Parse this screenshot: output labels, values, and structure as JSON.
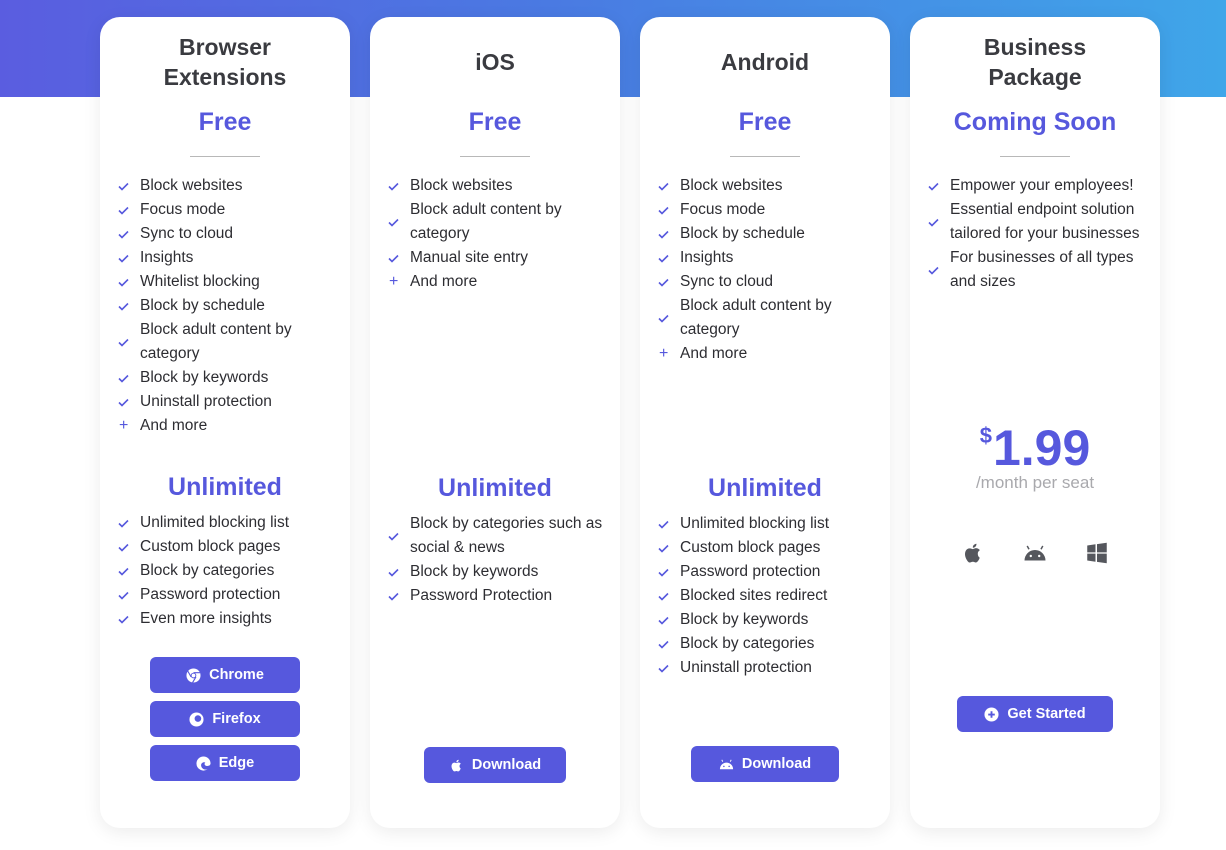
{
  "colors": {
    "accent": "#5658dd",
    "gradient_start": "#5a5de0",
    "gradient_end": "#3fa6e9",
    "title_text": "#3a3b40",
    "muted_text": "#a9a9ad"
  },
  "cards": [
    {
      "title": "Browser Extensions",
      "tier1": {
        "label": "Free",
        "features": [
          {
            "icon": "check-icon",
            "text": "Block websites"
          },
          {
            "icon": "check-icon",
            "text": "Focus mode"
          },
          {
            "icon": "check-icon",
            "text": "Sync to cloud"
          },
          {
            "icon": "check-icon",
            "text": "Insights"
          },
          {
            "icon": "check-icon",
            "text": "Whitelist blocking"
          },
          {
            "icon": "check-icon",
            "text": "Block by schedule"
          },
          {
            "icon": "check-icon",
            "text": "Block adult content by category"
          },
          {
            "icon": "check-icon",
            "text": "Block by keywords"
          },
          {
            "icon": "check-icon",
            "text": "Uninstall protection"
          },
          {
            "icon": "plus-icon",
            "text": "And more"
          }
        ]
      },
      "tier2": {
        "label": "Unlimited",
        "features": [
          {
            "icon": "check-icon",
            "text": "Unlimited blocking list"
          },
          {
            "icon": "check-icon",
            "text": "Custom block pages"
          },
          {
            "icon": "check-icon",
            "text": "Block by categories"
          },
          {
            "icon": "check-icon",
            "text": "Password protection"
          },
          {
            "icon": "check-icon",
            "text": "Even more insights"
          }
        ]
      },
      "buttons": [
        {
          "icon": "chrome-icon",
          "label": "Chrome"
        },
        {
          "icon": "firefox-icon",
          "label": "Firefox"
        },
        {
          "icon": "edge-icon",
          "label": "Edge"
        }
      ]
    },
    {
      "title": "iOS",
      "tier1": {
        "label": "Free",
        "features": [
          {
            "icon": "check-icon",
            "text": "Block websites"
          },
          {
            "icon": "check-icon",
            "text": "Block adult content by category"
          },
          {
            "icon": "check-icon",
            "text": "Manual site entry"
          },
          {
            "icon": "plus-icon",
            "text": "And more"
          }
        ]
      },
      "tier2": {
        "label": "Unlimited",
        "features": [
          {
            "icon": "check-icon",
            "text": "Block by categories such as social & news"
          },
          {
            "icon": "check-icon",
            "text": "Block by keywords"
          },
          {
            "icon": "check-icon",
            "text": "Password Protection"
          }
        ]
      },
      "buttons": [
        {
          "icon": "apple-icon",
          "label": "Download"
        }
      ]
    },
    {
      "title": "Android",
      "tier1": {
        "label": "Free",
        "features": [
          {
            "icon": "check-icon",
            "text": "Block websites"
          },
          {
            "icon": "check-icon",
            "text": "Focus mode"
          },
          {
            "icon": "check-icon",
            "text": "Block by schedule"
          },
          {
            "icon": "check-icon",
            "text": "Insights"
          },
          {
            "icon": "check-icon",
            "text": "Sync to cloud"
          },
          {
            "icon": "check-icon",
            "text": "Block adult content by category"
          },
          {
            "icon": "plus-icon",
            "text": "And more"
          }
        ]
      },
      "tier2": {
        "label": "Unlimited",
        "features": [
          {
            "icon": "check-icon",
            "text": "Unlimited blocking list"
          },
          {
            "icon": "check-icon",
            "text": "Custom block pages"
          },
          {
            "icon": "check-icon",
            "text": "Password protection"
          },
          {
            "icon": "check-icon",
            "text": "Blocked sites redirect"
          },
          {
            "icon": "check-icon",
            "text": "Block by keywords"
          },
          {
            "icon": "check-icon",
            "text": "Block by categories"
          },
          {
            "icon": "check-icon",
            "text": "Uninstall protection"
          }
        ]
      },
      "buttons": [
        {
          "icon": "android-icon",
          "label": "Download"
        }
      ]
    },
    {
      "title": "Business Package",
      "tier1": {
        "label": "Coming Soon",
        "features": [
          {
            "icon": "check-icon",
            "text": "Empower your employees!"
          },
          {
            "icon": "check-icon",
            "text": "Essential endpoint solution tailored for your businesses"
          },
          {
            "icon": "check-icon",
            "text": "For businesses of all types and sizes"
          }
        ]
      },
      "price": {
        "currency": "$",
        "amount": "1.99",
        "period": "/month per seat"
      },
      "platforms": [
        "apple-icon",
        "android-icon",
        "windows-icon"
      ],
      "buttons": [
        {
          "icon": "plus-circle-icon",
          "label": "Get Started"
        }
      ]
    }
  ]
}
